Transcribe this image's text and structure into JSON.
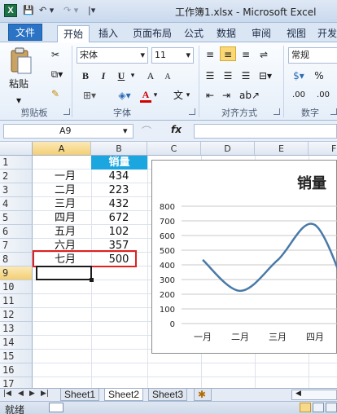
{
  "app": {
    "title": "工作簿1.xlsx - Microsoft Excel",
    "logo": "X"
  },
  "quick_access": {
    "save": "💾",
    "undo": "↶ ▾",
    "redo": "↷ ▾",
    "more": "|▾"
  },
  "tabs": [
    {
      "label": "文件"
    },
    {
      "label": "开始"
    },
    {
      "label": "插入"
    },
    {
      "label": "页面布局"
    },
    {
      "label": "公式"
    },
    {
      "label": "数据"
    },
    {
      "label": "审阅"
    },
    {
      "label": "视图"
    },
    {
      "label": "开发"
    }
  ],
  "ribbon": {
    "paste_label": "粘贴",
    "font_name": "宋体",
    "font_size": "11",
    "bold": "B",
    "italic": "I",
    "underline": "U",
    "grow_font": "A",
    "shrink_font": "A",
    "font_color": "A",
    "wen": "文",
    "number_format": "常规",
    "percent": "%",
    "inc_decimal": ".00",
    "dec_decimal": ".00",
    "groups": {
      "clipboard": "剪贴板",
      "font": "字体",
      "alignment": "对齐方式",
      "number": "数字"
    }
  },
  "formula_bar": {
    "name_box": "A9",
    "fx": "fx",
    "value": ""
  },
  "grid": {
    "columns": [
      "A",
      "B",
      "C",
      "D",
      "E",
      "F"
    ],
    "rows": [
      "1",
      "2",
      "3",
      "4",
      "5",
      "6",
      "7",
      "8",
      "9",
      "10",
      "11",
      "12",
      "13",
      "14",
      "15",
      "16",
      "17"
    ],
    "header_b1": "销量",
    "months": [
      "一月",
      "二月",
      "三月",
      "四月",
      "五月",
      "六月",
      "七月"
    ],
    "sales": [
      "434",
      "223",
      "432",
      "672",
      "102",
      "357",
      "500"
    ],
    "selected_cell": "A9",
    "highlight_color": "#1ca6e0",
    "annotation_color": "#e02020"
  },
  "chart_data": {
    "type": "line",
    "title": "销量",
    "categories": [
      "一月",
      "二月",
      "三月",
      "四月"
    ],
    "series": [
      {
        "values": [
          434,
          223,
          432,
          672
        ]
      }
    ],
    "yticks": [
      "800",
      "700",
      "600",
      "500",
      "400",
      "300",
      "200",
      "100",
      "0"
    ],
    "ylim": [
      0,
      800
    ],
    "color": "#4a7aa8",
    "grid": true
  },
  "sheets": [
    {
      "label": "Sheet1"
    },
    {
      "label": "Sheet2"
    },
    {
      "label": "Sheet3"
    }
  ],
  "status": {
    "ready": "就绪"
  }
}
